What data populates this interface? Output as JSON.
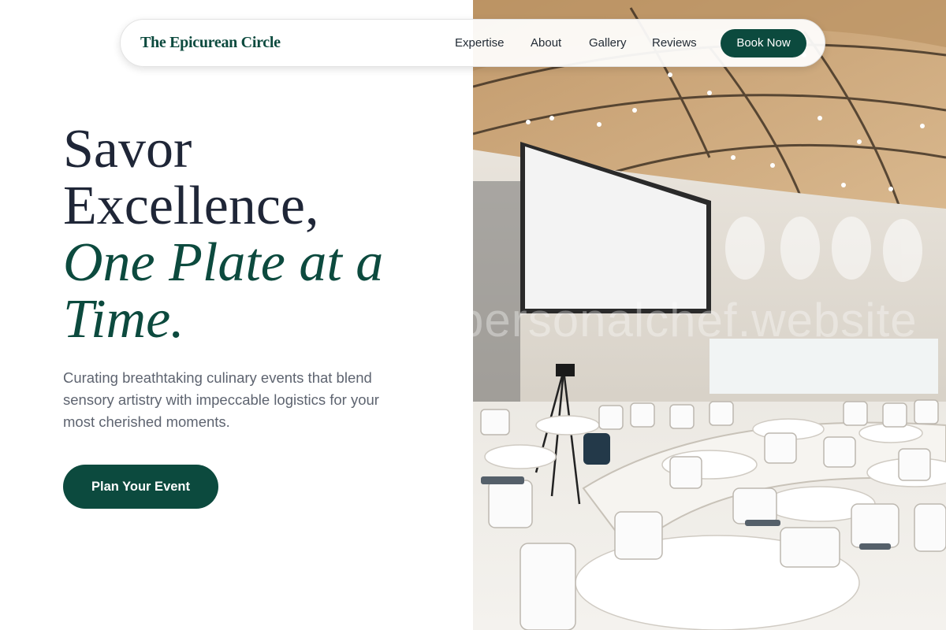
{
  "nav": {
    "brand": "The Epicurean Circle",
    "links": [
      "Expertise",
      "About",
      "Gallery",
      "Reviews"
    ],
    "cta_label": "Book Now"
  },
  "hero": {
    "headline_lines": [
      "Savor",
      "Excellence,"
    ],
    "headline_accent_lines": [
      "One Plate at a",
      "Time."
    ],
    "subtext": "Curating breathtaking culinary events that blend sensory artistry with impeccable logistics for your most cherished moments.",
    "cta_label": "Plan Your Event",
    "image_watermark": "personalchef.website"
  },
  "colors": {
    "brand_green": "#0c4a3e",
    "heading_navy": "#1f2637",
    "body_gray": "#5e6470"
  }
}
